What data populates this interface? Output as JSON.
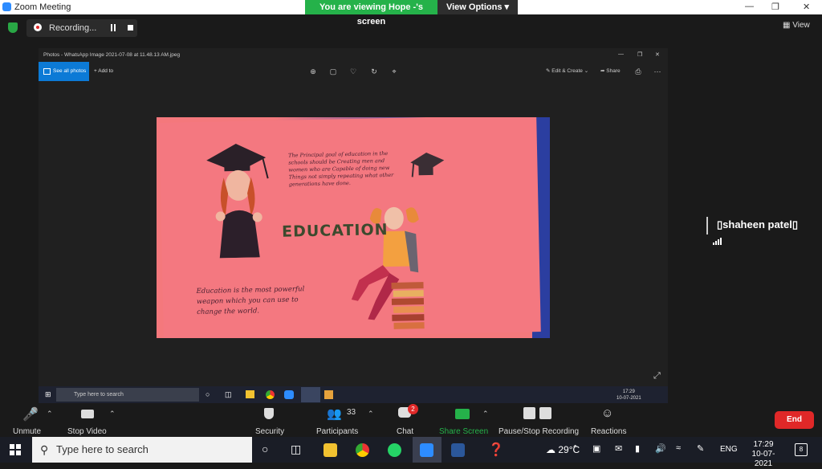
{
  "zoom": {
    "window_title": "Zoom Meeting",
    "banner_text": "You are viewing Hope -'s screen",
    "view_options_label": "View Options ▾",
    "recording_label": "Recording...",
    "view_label": "View",
    "participant_name": "▯shaheen patel▯"
  },
  "photos_app": {
    "window_title": "Photos - WhatsApp Image 2021-07-08 at 11.48.13 AM.jpeg",
    "see_all_label": "See all photos",
    "add_to_label": "Add to",
    "edit_create_label": "Edit & Create",
    "share_label": "Share",
    "image": {
      "quote_top": "The Principal goal of education in the schools should be Creating men and women who are Capable of doing new Things not simply repeating what other generations have done.",
      "heading": "EDUCATION",
      "quote_bottom": "Education is the most powerful weapon which you can use to change the world."
    },
    "inner_taskbar": {
      "search_placeholder": "Type here to search",
      "time": "17:29",
      "date": "10-07-2021"
    }
  },
  "controls": {
    "unmute_label": "Unmute",
    "stop_video_label": "Stop Video",
    "security_label": "Security",
    "participants_label": "Participants",
    "participants_count": "33",
    "chat_label": "Chat",
    "chat_badge": "2",
    "share_screen_label": "Share Screen",
    "recording_control_label": "Pause/Stop Recording",
    "reactions_label": "Reactions",
    "end_label": "End"
  },
  "taskbar": {
    "search_placeholder": "Type here to search",
    "weather": "29°C",
    "language": "ENG",
    "time": "17:29",
    "date": "10-07-2021",
    "notifications_count": "8"
  },
  "colors": {
    "share_green": "#25b24a",
    "end_red": "#e02828",
    "photos_blue": "#0c7ad6"
  }
}
